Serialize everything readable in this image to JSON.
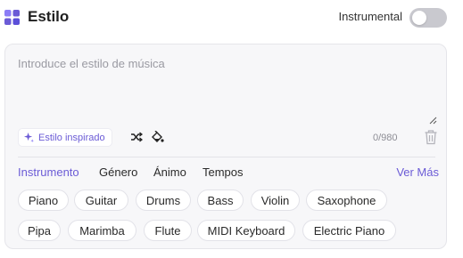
{
  "header": {
    "title": "Estilo",
    "instrumental_label": "Instrumental",
    "instrumental_on": false,
    "icon": "grid-apps-icon"
  },
  "style_input": {
    "placeholder": "Introduce el estilo de música",
    "value": ""
  },
  "toolbar": {
    "inspired_label": "Estilo inspirado",
    "counter": "0/980"
  },
  "tabs": [
    {
      "label": "Instrumento",
      "active": true
    },
    {
      "label": "Género",
      "active": false
    },
    {
      "label": "Ánimo",
      "active": false
    },
    {
      "label": "Tempos",
      "active": false
    }
  ],
  "see_more": "Ver Más",
  "chips": [
    {
      "label": "Piano"
    },
    {
      "label": "Guitar"
    },
    {
      "label": "Drums"
    },
    {
      "label": "Bass"
    },
    {
      "label": "Violin"
    },
    {
      "label": "Saxophone"
    },
    {
      "label": "Pipa"
    },
    {
      "label": "Marimba"
    },
    {
      "label": "Flute"
    },
    {
      "label": "MIDI Keyboard"
    },
    {
      "label": "Electric Piano"
    }
  ],
  "colors": {
    "accent": "#6b5bd6",
    "icon_gradient_start": "#8b7cf6",
    "icon_gradient_end": "#5b4fd8",
    "toggle_off": "#c9c9cf",
    "card_bg": "#f7f7f9"
  }
}
